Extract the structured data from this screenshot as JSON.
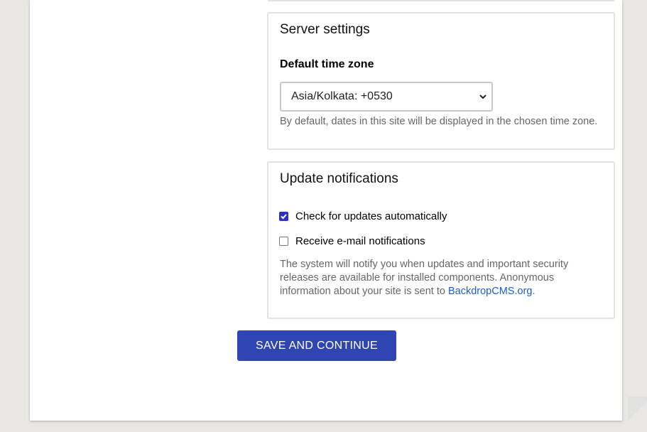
{
  "server_settings": {
    "legend": "Server settings",
    "timezone_label": "Default time zone",
    "timezone_value": "Asia/Kolkata: +0530",
    "timezone_description": "By default, dates in this site will be displayed in the chosen time zone."
  },
  "update_notifications": {
    "legend": "Update notifications",
    "check_updates_label": "Check for updates automatically",
    "check_updates_checked": true,
    "email_notifications_label": "Receive e-mail notifications",
    "email_notifications_checked": false,
    "description_prefix": "The system will notify you when updates and important security releases are available for installed components. Anonymous information about your site is sent to ",
    "description_link": "BackdropCMS.org",
    "description_suffix": "."
  },
  "actions": {
    "save_label": "SAVE AND CONTINUE"
  },
  "colors": {
    "accent": "#2f45b2",
    "checkbox": "#2f2ec8",
    "link": "#1a5fc7",
    "background": "#e8e7e4"
  }
}
